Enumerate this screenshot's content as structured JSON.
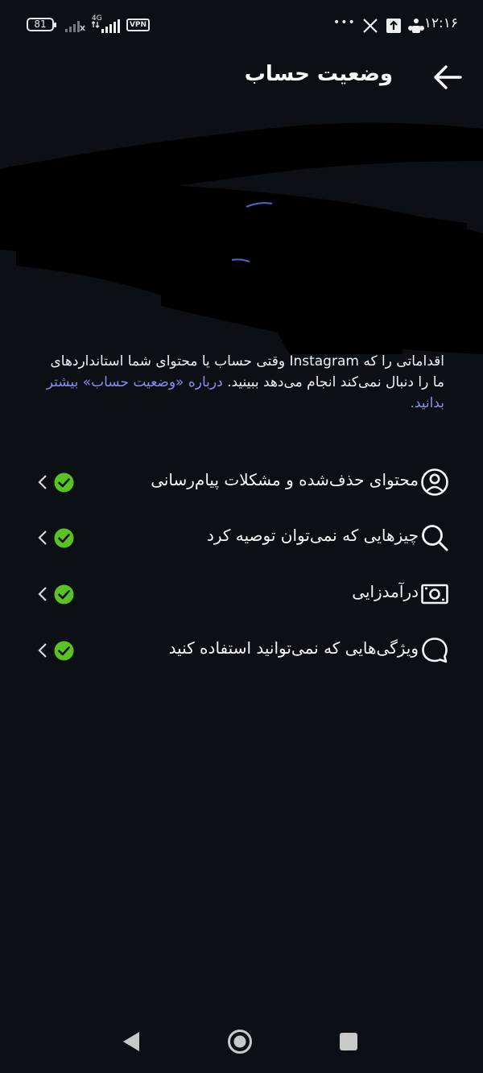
{
  "status_bar": {
    "battery": "81",
    "network": "4G",
    "vpn": "VPN",
    "more": "•••",
    "time": "۱۲:۱۶"
  },
  "header": {
    "title": "وضعیت حساب"
  },
  "description": {
    "text": "اقداماتی را که Instagram وقتی حساب یا محتوای شما استانداردهای ما را دنبال نمی‌کند انجام می‌دهد ببینید.",
    "link": "درباره «وضعیت حساب» بیشتر بدانید."
  },
  "status_items": [
    {
      "label": "محتوای حذف‌شده و مشکلات پیام‌رسانی",
      "icon": "user-circle-icon"
    },
    {
      "label": "چیزهایی که نمی‌توان توصیه کرد",
      "icon": "search-icon"
    },
    {
      "label": "درآمدزایی",
      "icon": "money-icon"
    },
    {
      "label": "ویژگی‌هایی که نمی‌توانید استفاده کنید",
      "icon": "chat-bubble-icon"
    }
  ],
  "colors": {
    "background": "#0c1014",
    "check": "#58c322",
    "link": "#8a8cf3"
  }
}
